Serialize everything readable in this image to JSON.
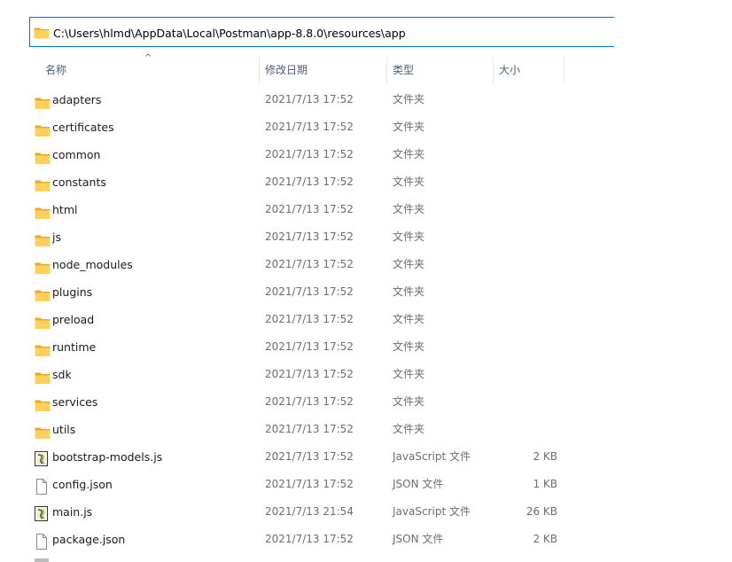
{
  "address_bar": {
    "path": "C:\\Users\\hlmd\\AppData\\Local\\Postman\\app-8.8.0\\resources\\app"
  },
  "columns": {
    "name": "名称",
    "modified": "修改日期",
    "type": "类型",
    "size": "大小"
  },
  "colors": {
    "folder_front": "#FFD15C",
    "folder_back": "#E8A92B",
    "header_text": "#4c607a",
    "accent": "#0078d7"
  },
  "files": [
    {
      "name": "adapters",
      "modified": "2021/7/13 17:52",
      "type": "文件夹",
      "size": "",
      "icon": "folder-icon"
    },
    {
      "name": "certificates",
      "modified": "2021/7/13 17:52",
      "type": "文件夹",
      "size": "",
      "icon": "folder-icon"
    },
    {
      "name": "common",
      "modified": "2021/7/13 17:52",
      "type": "文件夹",
      "size": "",
      "icon": "folder-icon"
    },
    {
      "name": "constants",
      "modified": "2021/7/13 17:52",
      "type": "文件夹",
      "size": "",
      "icon": "folder-icon"
    },
    {
      "name": "html",
      "modified": "2021/7/13 17:52",
      "type": "文件夹",
      "size": "",
      "icon": "folder-icon"
    },
    {
      "name": "js",
      "modified": "2021/7/13 17:52",
      "type": "文件夹",
      "size": "",
      "icon": "folder-icon"
    },
    {
      "name": "node_modules",
      "modified": "2021/7/13 17:52",
      "type": "文件夹",
      "size": "",
      "icon": "folder-icon"
    },
    {
      "name": "plugins",
      "modified": "2021/7/13 17:52",
      "type": "文件夹",
      "size": "",
      "icon": "folder-icon"
    },
    {
      "name": "preload",
      "modified": "2021/7/13 17:52",
      "type": "文件夹",
      "size": "",
      "icon": "folder-icon"
    },
    {
      "name": "runtime",
      "modified": "2021/7/13 17:52",
      "type": "文件夹",
      "size": "",
      "icon": "folder-icon"
    },
    {
      "name": "sdk",
      "modified": "2021/7/13 17:52",
      "type": "文件夹",
      "size": "",
      "icon": "folder-icon"
    },
    {
      "name": "services",
      "modified": "2021/7/13 17:52",
      "type": "文件夹",
      "size": "",
      "icon": "folder-icon"
    },
    {
      "name": "utils",
      "modified": "2021/7/13 17:52",
      "type": "文件夹",
      "size": "",
      "icon": "folder-icon"
    },
    {
      "name": "bootstrap-models.js",
      "modified": "2021/7/13 17:52",
      "type": "JavaScript 文件",
      "size": "2 KB",
      "icon": "script-file-icon"
    },
    {
      "name": "config.json",
      "modified": "2021/7/13 17:52",
      "type": "JSON 文件",
      "size": "1 KB",
      "icon": "file-icon"
    },
    {
      "name": "main.js",
      "modified": "2021/7/13 21:54",
      "type": "JavaScript 文件",
      "size": "26 KB",
      "icon": "script-file-icon"
    },
    {
      "name": "package.json",
      "modified": "2021/7/13 17:52",
      "type": "JSON 文件",
      "size": "2 KB",
      "icon": "file-icon"
    }
  ]
}
